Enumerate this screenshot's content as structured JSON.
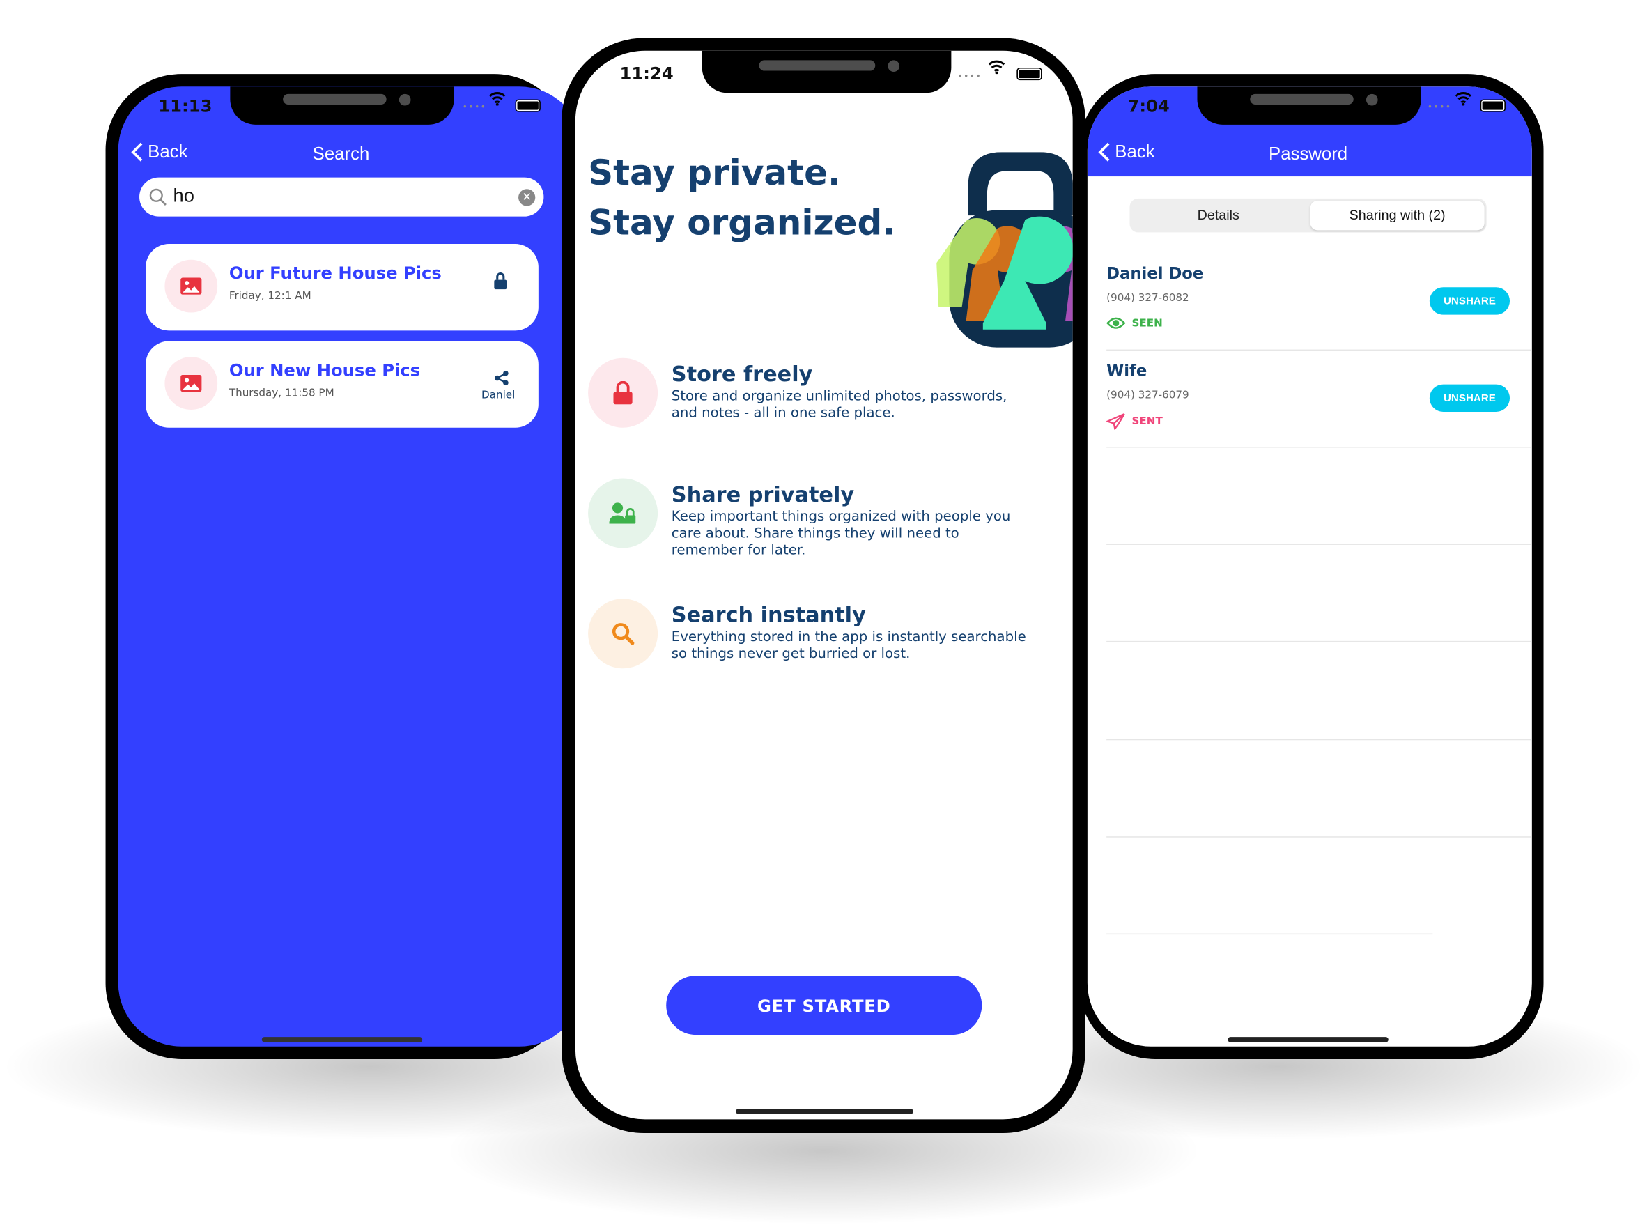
{
  "colors": {
    "primary": "#3340ff",
    "navy": "#15406f",
    "accent_cyan": "#00c8ee",
    "seen_green": "#3db24b",
    "sent_pink": "#f0457a",
    "icon_bg_pink": "#fde8ec",
    "icon_red": "#e8333f"
  },
  "left_phone": {
    "status_time": "11:13",
    "nav": {
      "back_label": "Back",
      "title": "Search"
    },
    "search": {
      "value": "ho",
      "placeholder": ""
    },
    "results": [
      {
        "title": "Our Future House Pics",
        "date": "Friday, 12:1 AM",
        "icon": "image-icon",
        "badge_icon": "lock-icon",
        "badge_label": ""
      },
      {
        "title": "Our New House Pics",
        "date": "Thursday, 11:58 PM",
        "icon": "image-icon",
        "badge_icon": "share-icon",
        "badge_label": "Daniel"
      }
    ]
  },
  "center_phone": {
    "status_time": "11:24",
    "headline": [
      "Stay private.",
      "Stay organized."
    ],
    "features": [
      {
        "icon": "lock-icon",
        "title": "Store freely",
        "desc": "Store and organize unlimited photos, passwords, and notes - all in one safe place."
      },
      {
        "icon": "user-lock-icon",
        "title": "Share privately",
        "desc": "Keep important things organized with people you care about. Share things they will need to remember for later."
      },
      {
        "icon": "search-icon",
        "title": "Search instantly",
        "desc": "Everything stored in the app is instantly searchable so things never get burried or lost."
      }
    ],
    "cta_label": "GET STARTED"
  },
  "right_phone": {
    "status_time": "7:04",
    "nav": {
      "back_label": "Back",
      "title": "Password"
    },
    "segments": [
      {
        "label": "Details",
        "selected": false
      },
      {
        "label": "Sharing with (2)",
        "selected": true
      }
    ],
    "shares": [
      {
        "name": "Daniel Doe",
        "phone": "(904) 327-6082",
        "status": "SEEN",
        "status_icon": "eye-icon",
        "action": "UNSHARE"
      },
      {
        "name": "Wife",
        "phone": "(904) 327-6079",
        "status": "SENT",
        "status_icon": "paper-plane-icon",
        "action": "UNSHARE"
      }
    ]
  }
}
